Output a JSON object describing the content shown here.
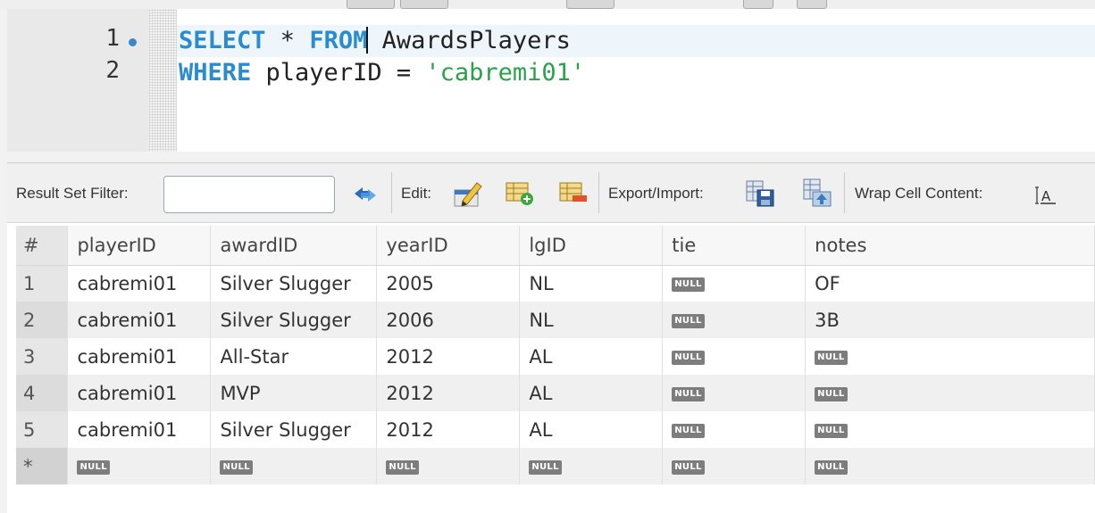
{
  "editor": {
    "lines": [
      {
        "number": "1",
        "tokens": {
          "kw1": "SELECT",
          "p1": " * ",
          "kw2": "FROM",
          "p2": " AwardsPlayers"
        }
      },
      {
        "number": "2",
        "tokens": {
          "kw1": "WHERE",
          "p1": " playerID = ",
          "str": "'cabremi01'"
        }
      }
    ]
  },
  "result_toolbar": {
    "filter_label": "Result Set Filter:",
    "filter_value": "",
    "refresh_icon": "refresh-icon",
    "edit_label": "Edit:",
    "edit_icon": "edit-pencil-icon",
    "add_row_icon": "add-row-icon",
    "delete_row_icon": "delete-row-icon",
    "export_label": "Export/Import:",
    "export_icon": "export-save-icon",
    "import_icon": "import-icon",
    "wrap_label": "Wrap Cell Content:",
    "wrap_icon": "wrap-cell-icon"
  },
  "grid": {
    "columns": [
      "#",
      "playerID",
      "awardID",
      "yearID",
      "lgID",
      "tie",
      "notes"
    ],
    "null_text": "NULL",
    "rows": [
      {
        "n": "1",
        "playerID": "cabremi01",
        "awardID": "Silver Slugger",
        "yearID": "2005",
        "lgID": "NL",
        "tie": null,
        "notes": "OF"
      },
      {
        "n": "2",
        "playerID": "cabremi01",
        "awardID": "Silver Slugger",
        "yearID": "2006",
        "lgID": "NL",
        "tie": null,
        "notes": "3B"
      },
      {
        "n": "3",
        "playerID": "cabremi01",
        "awardID": "All-Star",
        "yearID": "2012",
        "lgID": "AL",
        "tie": null,
        "notes": null
      },
      {
        "n": "4",
        "playerID": "cabremi01",
        "awardID": "MVP",
        "yearID": "2012",
        "lgID": "AL",
        "tie": null,
        "notes": null
      },
      {
        "n": "5",
        "playerID": "cabremi01",
        "awardID": "Silver Slugger",
        "yearID": "2012",
        "lgID": "AL",
        "tie": null,
        "notes": null
      },
      {
        "n": "*",
        "playerID": null,
        "awardID": null,
        "yearID": null,
        "lgID": null,
        "tie": null,
        "notes": null
      }
    ]
  },
  "colors": {
    "keyword": "#2a8cd0",
    "string": "#2aa24a",
    "null_badge": "#7d7d7d"
  }
}
